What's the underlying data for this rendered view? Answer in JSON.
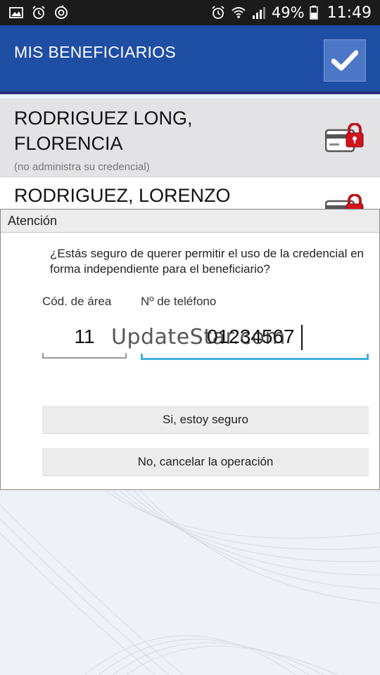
{
  "status_bar": {
    "battery": "49%",
    "time": "11:49",
    "left_icons": [
      "image-icon",
      "alarm-icon",
      "sync-icon"
    ],
    "right_icons": [
      "alarm-icon",
      "wifi-icon",
      "signal-icon",
      "battery-icon"
    ]
  },
  "app_bar": {
    "title": "MIS BENEFICIARIOS",
    "confirm_icon": "check-icon",
    "color": "#1f4ea5"
  },
  "beneficiaries": [
    {
      "name": "RODRIGUEZ LONG, FLORENCIA",
      "note": "(no administra su credencial)",
      "icon": "locked-card-icon"
    },
    {
      "name": "RODRIGUEZ, LORENZO",
      "icon": "locked-card-icon"
    }
  ],
  "dialog": {
    "title": "Atención",
    "message": "¿Estás seguro de querer permitir el uso de la credencial en forma independiente para el beneficiario?",
    "area_code_label": "Cód. de área",
    "area_code_value": "11",
    "phone_label": "Nº de teléfono",
    "phone_value": "01234567",
    "confirm_button": "Si, estoy seguro",
    "cancel_button": "No, cancelar la operación",
    "accent_color": "#3db2e2"
  },
  "watermark": "UpdateStar.com"
}
